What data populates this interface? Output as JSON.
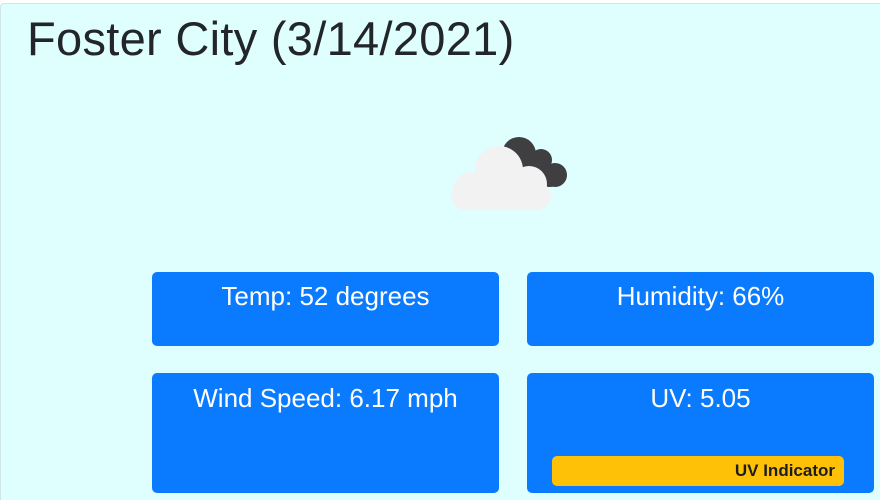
{
  "header": {
    "title": "Foster City (3/14/2021)"
  },
  "weather": {
    "icon": "cloudy-icon",
    "temp": "Temp: 52 degrees",
    "humidity": "Humidity: 66%",
    "wind": "Wind Speed: 6.17 mph",
    "uv": "UV: 5.05",
    "uv_indicator": {
      "label": "UV Indicator",
      "color": "#ffc108"
    }
  },
  "colors": {
    "background": "#dfffff",
    "card": "#0a7bff",
    "title": "#222529"
  }
}
